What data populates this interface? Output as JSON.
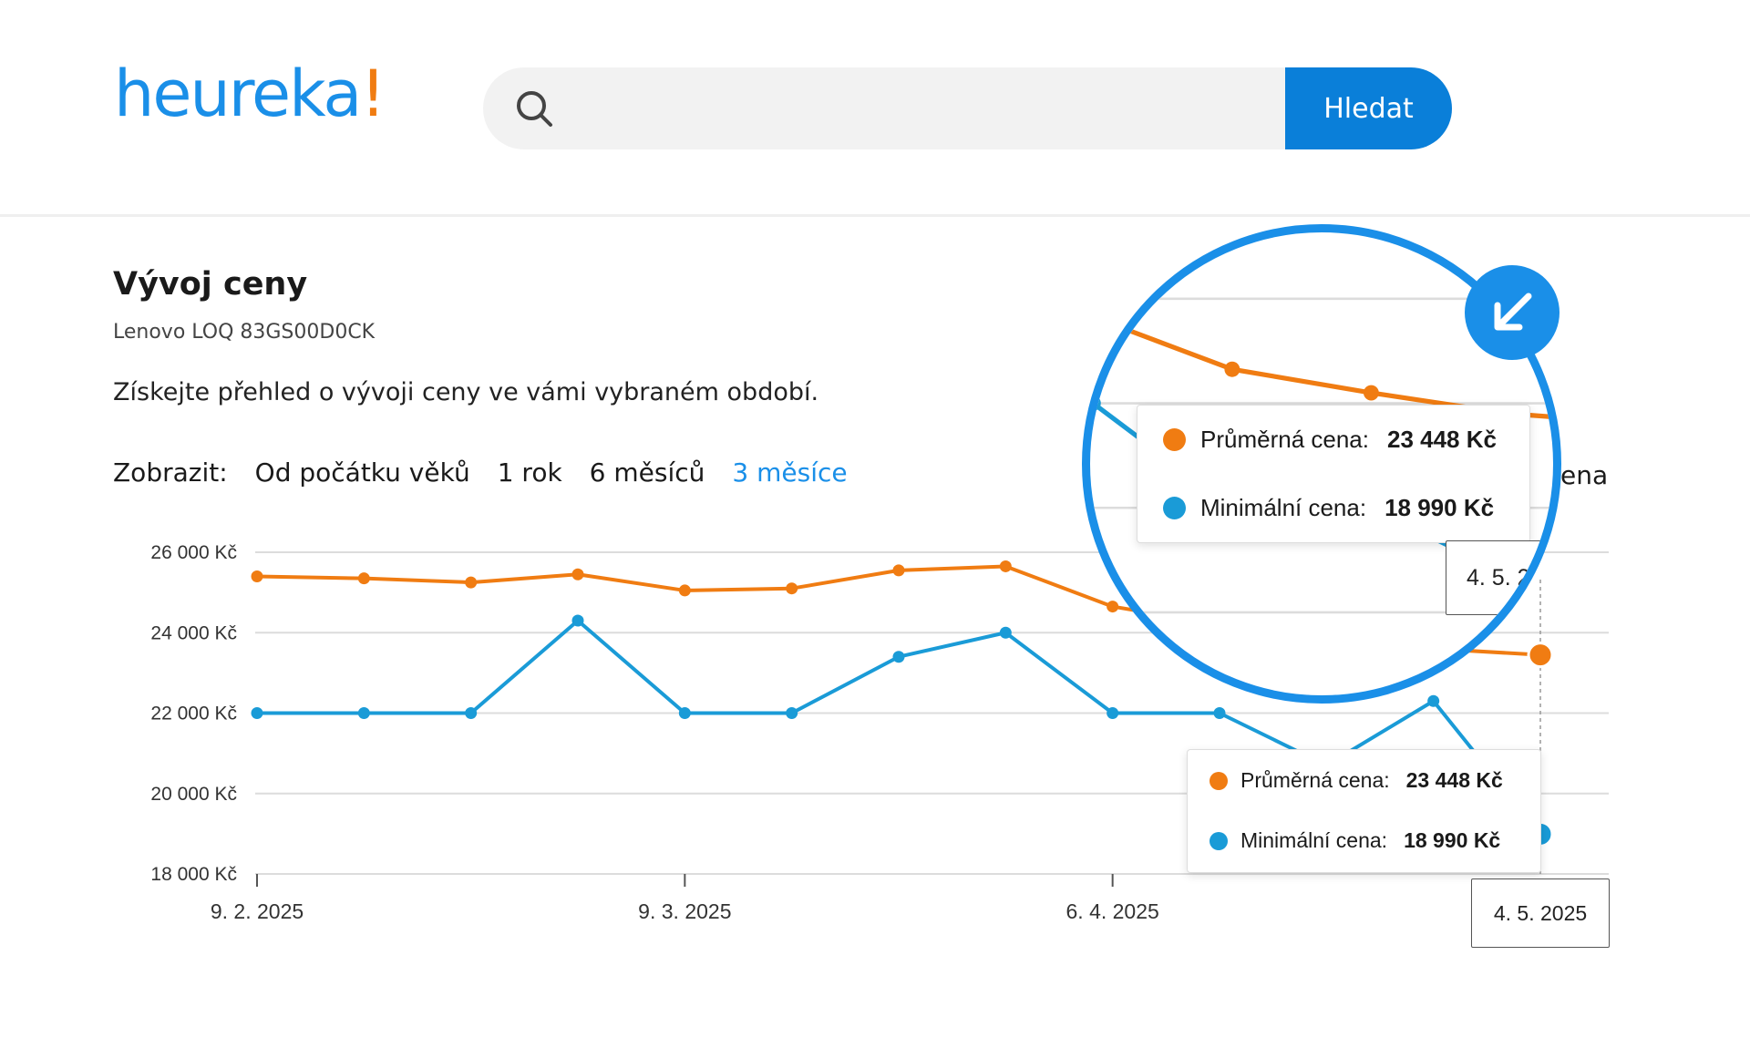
{
  "header": {
    "logo_text": "heureka",
    "logo_mark": "!",
    "search_placeholder": "",
    "search_button": "Hledat"
  },
  "section": {
    "title": "Vývoj ceny",
    "product": "Lenovo LOQ 83GS00D0CK",
    "description": "Získejte přehled o vývoji ceny ve vámi vybraném období."
  },
  "filters": {
    "label": "Zobrazit:",
    "options": [
      "Od počátku věků",
      "1 rok",
      "6 měsíců",
      "3 měsíce"
    ],
    "active": "3 měsíce"
  },
  "colors": {
    "avg": "#f07c12",
    "min": "#1a9bd7",
    "accent": "#1a8fe8"
  },
  "chart_data": {
    "type": "line",
    "x": [
      "9. 2. 2025",
      "16. 2. 2025",
      "23. 2. 2025",
      "2. 3. 2025",
      "9. 3. 2025",
      "16. 3. 2025",
      "23. 3. 2025",
      "30. 3. 2025",
      "6. 4. 2025",
      "13. 4. 2025",
      "20. 4. 2025",
      "27. 4. 2025",
      "4. 5. 2025"
    ],
    "x_tick_labels": [
      "9. 2. 2025",
      "9. 3. 2025",
      "6. 4. 2025"
    ],
    "y_tick_labels": [
      "26 000 Kč",
      "24 000 Kč",
      "22 000 Kč",
      "20 000 Kč",
      "18 000 Kč"
    ],
    "y_ticks": [
      26000,
      24000,
      22000,
      20000,
      18000
    ],
    "ylim": [
      18000,
      26000
    ],
    "series": [
      {
        "name": "Průměrná cena",
        "values": [
          25400,
          25350,
          25250,
          25450,
          25050,
          25100,
          25550,
          25650,
          24650,
          24200,
          23800,
          23600,
          23448
        ]
      },
      {
        "name": "Minimální cena",
        "values": [
          22000,
          22000,
          22000,
          24300,
          22000,
          22000,
          23400,
          24000,
          22000,
          22000,
          20700,
          22300,
          18990
        ]
      }
    ]
  },
  "tooltip": {
    "avg_label": "Průměrná cena:",
    "avg_value": "23 448 Kč",
    "min_label": "Minimální cena:",
    "min_value": "18 990 Kč",
    "date": "4. 5. 2025",
    "date_clipped": "4. 5. 2",
    "legend_fragment": "ena"
  }
}
